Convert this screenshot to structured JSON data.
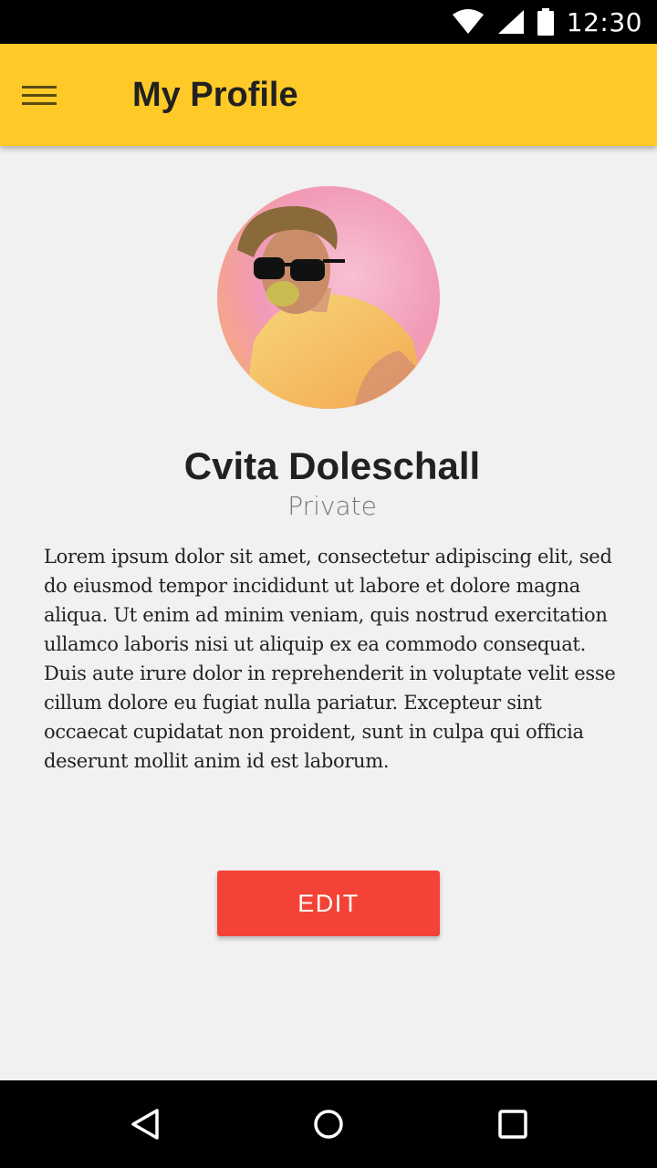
{
  "status_bar": {
    "time": "12:30",
    "icons": [
      "wifi-icon",
      "signal-icon",
      "battery-icon"
    ]
  },
  "app_bar": {
    "title": "My Profile",
    "menu_icon": "hamburger-menu-icon",
    "background_color": "#FFCA28"
  },
  "profile": {
    "avatar_icon": "profile-photo",
    "name": "Cvita Doleschall",
    "role": "Private",
    "bio": "Lorem ipsum dolor sit amet, consectetur adipiscing elit, sed do eiusmod tempor incididunt ut labore et dolore magna aliqua. Ut enim ad minim veniam, quis nostrud exercitation ullamco laboris nisi ut aliquip ex ea commodo consequat. Duis aute irure dolor in reprehenderit in voluptate velit esse cillum dolore eu fugiat nulla pariatur. Excepteur sint occaecat cupidatat non proident, sunt in culpa qui officia deserunt mollit anim id est laborum."
  },
  "actions": {
    "edit_label": "EDIT",
    "edit_color": "#F44336"
  },
  "nav_bar": {
    "buttons": [
      "back-icon",
      "home-icon",
      "recents-icon"
    ]
  }
}
